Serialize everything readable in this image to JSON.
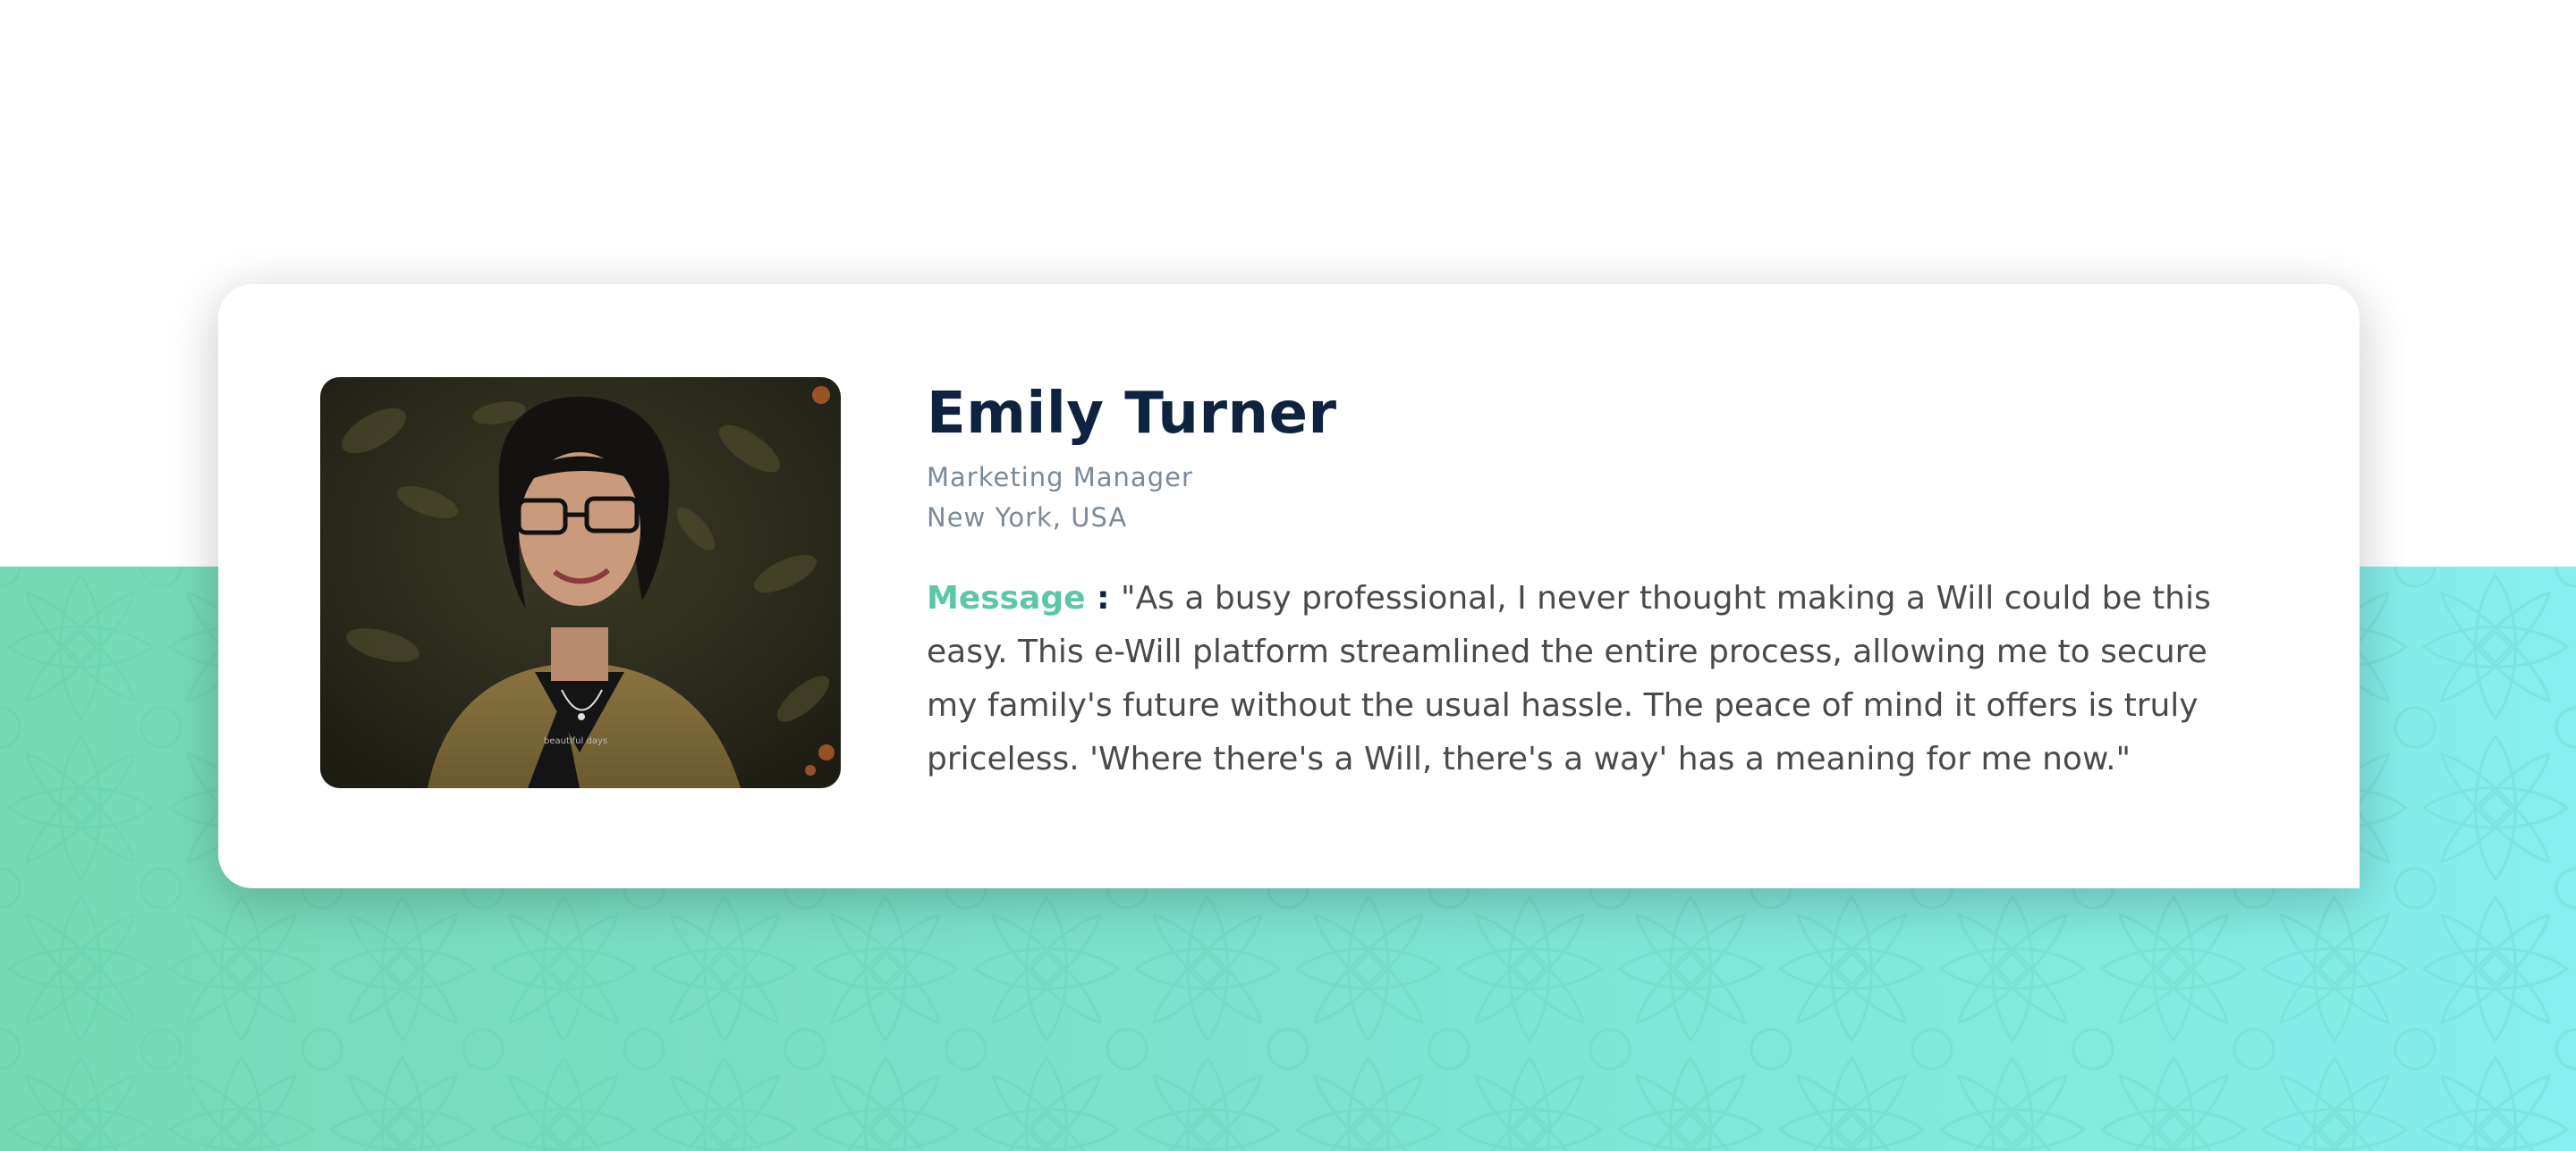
{
  "testimonial": {
    "name": "Emily Turner",
    "role": "Marketing Manager",
    "location": "New York, USA",
    "message_label": "Message",
    "message_separator": " : ",
    "message_text": "\"As a busy professional, I never thought making a Will could be this easy. This e-Will platform streamlined the entire process, allowing me to secure my family's future without the usual hassle. The peace of mind it offers is truly priceless. 'Where there's a Will, there's a way' has a meaning for me now.\""
  },
  "colors": {
    "accent": "#5cc7a6",
    "name": "#0f2340",
    "meta": "#7a8a99",
    "body_text": "#4a4a4a",
    "band_left": "#74d9b4",
    "band_right": "#86eeec"
  },
  "icons": {
    "avatar": "profile-photo"
  }
}
